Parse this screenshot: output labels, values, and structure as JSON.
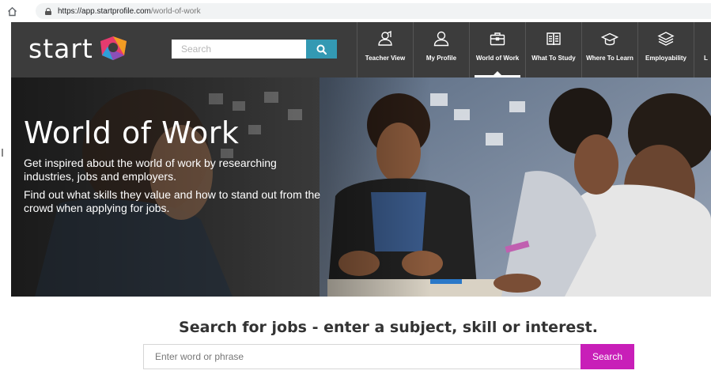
{
  "browser": {
    "url_host": "https://app.startprofile.com",
    "url_path": "/world-of-work",
    "home_icon": "home-icon",
    "lock_icon": "lock-icon"
  },
  "header": {
    "logo_text": "start",
    "search": {
      "placeholder": "Search",
      "button_icon": "search-icon"
    },
    "nav": [
      {
        "label": "Teacher View",
        "icon": "teacher-icon",
        "active": false
      },
      {
        "label": "My Profile",
        "icon": "person-icon",
        "active": false
      },
      {
        "label": "World of Work",
        "icon": "briefcase-icon",
        "active": true
      },
      {
        "label": "What To Study",
        "icon": "book-icon",
        "active": false
      },
      {
        "label": "Where To Learn",
        "icon": "graduation-cap-icon",
        "active": false
      },
      {
        "label": "Employability",
        "icon": "layers-icon",
        "active": false
      },
      {
        "label": "L",
        "icon": "",
        "active": false
      }
    ]
  },
  "hero": {
    "title": "World of Work",
    "paragraph1": "Get inspired about the world of work by researching industries, jobs and employers.",
    "paragraph2": "Find out what skills they value and how to stand out from the crowd when applying for jobs."
  },
  "job_search": {
    "heading": "Search for jobs - enter a subject, skill or interest.",
    "placeholder": "Enter word or phrase",
    "button_label": "Search"
  },
  "colors": {
    "header_bg": "#3c3c3c",
    "search_button": "#3399b3",
    "job_search_button": "#c81fb8",
    "heading_text": "#333333"
  }
}
